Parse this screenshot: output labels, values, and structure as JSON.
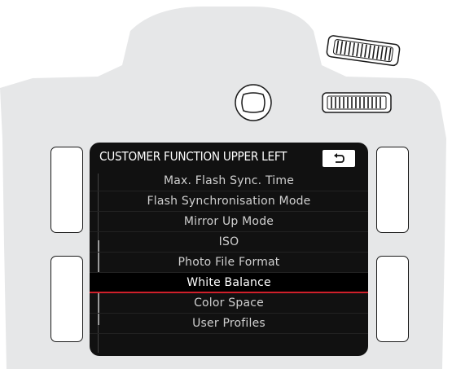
{
  "header": {
    "title": "CUSTOMER FUNCTION UPPER LEFT"
  },
  "back_button": {
    "icon": "back-arrow-icon"
  },
  "menu": {
    "items": [
      {
        "label": "Max. Flash Sync. Time"
      },
      {
        "label": "Flash Synchronisation Mode"
      },
      {
        "label": "Mirror Up Mode"
      },
      {
        "label": "ISO"
      },
      {
        "label": "Photo File Format"
      },
      {
        "label": "White Balance"
      },
      {
        "label": "Color Space"
      },
      {
        "label": "User Profiles"
      }
    ],
    "selected_index": 5
  },
  "colors": {
    "camera_body": "#e6e7e8",
    "screen_bg": "#111111",
    "selection_underline": "#d0202b"
  }
}
